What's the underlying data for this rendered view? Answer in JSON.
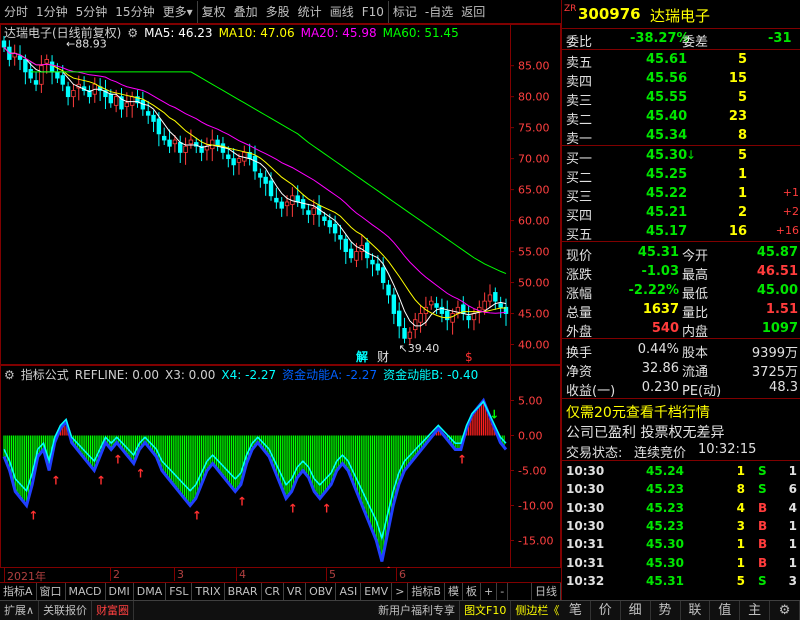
{
  "toolbar": {
    "items": [
      "分时",
      "1分钟",
      "5分钟",
      "15分钟",
      "更多",
      "复权",
      "叠加",
      "多股",
      "统计",
      "画线",
      "F10",
      "标记",
      "-自选",
      "返回"
    ],
    "more_chevron": "▾"
  },
  "main_header": {
    "title": "达瑞电子(日线前复权)",
    "ma5": "MA5: 46.23",
    "ma10": "MA10: 47.06",
    "ma20": "MA20: 45.98",
    "ma60": "MA60: 51.45"
  },
  "colors": {
    "up": "#ff3c3c",
    "down": "#00ffff",
    "ma5": "#ffffff",
    "ma10": "#ffff00",
    "ma20": "#ff00ff",
    "ma60": "#00ff00",
    "panel_border": "#800000"
  },
  "chart_data": [
    {
      "type": "candlestick",
      "title": "达瑞电子(日线前复权)",
      "y_ticks": [
        85.0,
        80.0,
        75.0,
        70.0,
        65.0,
        60.0,
        55.0,
        50.0,
        45.0,
        40.0
      ],
      "ylim": [
        37.5,
        88.5
      ],
      "x_ticks": [
        "2021年",
        "2",
        "3",
        "4",
        "5",
        "6"
      ],
      "annotations": {
        "high": "88.93",
        "low": "39.40",
        "mark1": "解",
        "mark2": "财",
        "mark3": "$"
      },
      "close": [
        88,
        86,
        87,
        86,
        84,
        83,
        82,
        85,
        86,
        84,
        83,
        82,
        80,
        81,
        82,
        81,
        80,
        82,
        81,
        80,
        79,
        80,
        78,
        79,
        80,
        79,
        78,
        77,
        76,
        74,
        73,
        72,
        73,
        71,
        72,
        73,
        72,
        71,
        72,
        73,
        72,
        71,
        70,
        69,
        70,
        71,
        70,
        68,
        67,
        66,
        64,
        63,
        62,
        63,
        64,
        63,
        62,
        61,
        62,
        61,
        60,
        59,
        58,
        57,
        55,
        54,
        55,
        56,
        54,
        53,
        52,
        50,
        48,
        45,
        43,
        41,
        42,
        44,
        45,
        46,
        47,
        46,
        45,
        44,
        45,
        46,
        45,
        44,
        45,
        46,
        47,
        48,
        47,
        46,
        45
      ],
      "ma60": [
        84,
        84,
        84,
        84,
        84,
        84,
        84,
        84,
        84,
        84,
        84,
        84,
        84,
        84,
        84,
        84,
        84,
        84,
        84,
        84,
        84,
        84,
        84,
        84,
        84,
        84,
        84,
        84,
        84,
        84,
        84,
        83.5,
        83,
        82.5,
        82,
        81.5,
        81,
        80.5,
        80,
        79.5,
        79,
        78.5,
        78,
        77.5,
        77,
        76.5,
        76,
        75.5,
        75,
        74.5,
        74,
        73.3,
        72.6,
        72,
        71.4,
        70.8,
        70.2,
        69.6,
        69,
        68.4,
        67.8,
        67.2,
        66.6,
        66,
        65.4,
        64.8,
        64.2,
        63.6,
        63,
        62.4,
        61.8,
        61.2,
        60.6,
        60,
        59.4,
        58.8,
        58.2,
        57.6,
        57,
        56.4,
        55.8,
        55.2,
        54.6,
        54,
        53.5,
        53,
        52.6,
        52.2,
        51.8,
        51.45
      ]
    },
    {
      "type": "area",
      "title": "指标公式",
      "labels": {
        "refline": "REFLINE: 0.00",
        "x3": "X3: 0.00",
        "x4": "X4: -2.27",
        "a": "资金动能A: -2.27",
        "b": "资金动能B: -0.40"
      },
      "y_ticks": [
        5.0,
        0.0,
        -5.0,
        -10.0,
        -15.0
      ],
      "ylim": [
        -18.5,
        7.5
      ],
      "values": [
        -3,
        -5,
        -8,
        -9,
        -10,
        -7,
        -3,
        -2,
        -5,
        -1,
        1,
        2,
        -1,
        -2,
        -3,
        -4,
        -5,
        -3,
        -1,
        -2,
        -1,
        -2,
        -3,
        -4,
        -2,
        -1,
        -2,
        -3,
        -5,
        -6,
        -7,
        -8,
        -9,
        -10,
        -9,
        -7,
        -5,
        -4,
        -5,
        -6,
        -7,
        -8,
        -7,
        -4,
        -2,
        -1,
        -2,
        -3,
        -5,
        -7,
        -9,
        -8,
        -6,
        -5,
        -6,
        -8,
        -9,
        -8,
        -7,
        -5,
        -4,
        -5,
        -7,
        -9,
        -11,
        -13,
        -15,
        -18,
        -14,
        -10,
        -7,
        -5,
        -4,
        -3,
        -2,
        -1,
        0,
        1,
        0,
        -1,
        -2,
        -2,
        1,
        3,
        4,
        5,
        3,
        1,
        -1,
        -2
      ]
    }
  ],
  "bottom_tabs": [
    "指标A",
    "窗口",
    "MACD",
    "DMI",
    "DMA",
    "FSL",
    "TRIX",
    "BRAR",
    "CR",
    "VR",
    "OBV",
    "ASI",
    "EMV",
    ">",
    "指标B",
    "模",
    "板",
    "+",
    "-",
    "日线"
  ],
  "status_bar": [
    "扩展∧",
    "关联报价",
    "财富圈",
    "新用户福利专享",
    "图文F10",
    "侧边栏《"
  ],
  "quote": {
    "code": "300976",
    "name": "达瑞电子",
    "zr": "ZR",
    "wei_bi_label": "委比",
    "wei_bi": "-38.27%",
    "wei_cha_label": "委差",
    "wei_cha": "-31",
    "asks": [
      {
        "label": "卖五",
        "price": "45.61",
        "vol": "5"
      },
      {
        "label": "卖四",
        "price": "45.56",
        "vol": "15"
      },
      {
        "label": "卖三",
        "price": "45.55",
        "vol": "5"
      },
      {
        "label": "卖二",
        "price": "45.40",
        "vol": "23"
      },
      {
        "label": "卖一",
        "price": "45.34",
        "vol": "8"
      }
    ],
    "bids": [
      {
        "label": "买一",
        "price": "45.30",
        "vol": "5",
        "chg": "",
        "arrow": "↓"
      },
      {
        "label": "买二",
        "price": "45.25",
        "vol": "1",
        "chg": "",
        "arrow": ""
      },
      {
        "label": "买三",
        "price": "45.22",
        "vol": "1",
        "chg": "+1",
        "arrow": ""
      },
      {
        "label": "买四",
        "price": "45.21",
        "vol": "2",
        "chg": "+2",
        "arrow": ""
      },
      {
        "label": "买五",
        "price": "45.17",
        "vol": "16",
        "chg": "+16",
        "arrow": ""
      }
    ],
    "stats": [
      {
        "l1": "现价",
        "v1": "45.31",
        "c1": "grn",
        "l2": "今开",
        "v2": "45.87",
        "c2": "grn"
      },
      {
        "l1": "涨跌",
        "v1": "-1.03",
        "c1": "grn",
        "l2": "最高",
        "v2": "46.51",
        "c2": "red"
      },
      {
        "l1": "涨幅",
        "v1": "-2.22%",
        "c1": "grn",
        "l2": "最低",
        "v2": "45.00",
        "c2": "grn"
      },
      {
        "l1": "总量",
        "v1": "1637",
        "c1": "yel",
        "l2": "量比",
        "v2": "1.51",
        "c2": "red"
      },
      {
        "l1": "外盘",
        "v1": "540",
        "c1": "red",
        "l2": "内盘",
        "v2": "1097",
        "c2": "grn"
      }
    ],
    "fin": [
      {
        "l1": "换手",
        "v1": "0.44%",
        "l2": "股本",
        "v2": "9399万"
      },
      {
        "l1": "净资",
        "v1": "32.86",
        "l2": "流通",
        "v2": "3725万"
      },
      {
        "l1": "收益(一)",
        "v1": "0.230",
        "l2": "PE(动)",
        "v2": "48.3"
      }
    ],
    "promo": "仅需20元查看千档行情",
    "note": "公司已盈利 投票权无差异",
    "trade_state_label": "交易状态:",
    "trade_state": "连续竞价",
    "trade_time": "10:32:15",
    "ticks": [
      {
        "t": "10:30",
        "p": "45.24",
        "v": "1",
        "s": "S",
        "n": "1"
      },
      {
        "t": "10:30",
        "p": "45.23",
        "v": "8",
        "s": "S",
        "n": "6"
      },
      {
        "t": "10:30",
        "p": "45.23",
        "v": "4",
        "s": "B",
        "n": "4"
      },
      {
        "t": "10:30",
        "p": "45.23",
        "v": "3",
        "s": "B",
        "n": "1"
      },
      {
        "t": "10:31",
        "p": "45.30",
        "v": "1",
        "s": "B",
        "n": "1"
      },
      {
        "t": "10:31",
        "p": "45.30",
        "v": "1",
        "s": "B",
        "n": "1"
      },
      {
        "t": "10:32",
        "p": "45.31",
        "v": "5",
        "s": "S",
        "n": "3"
      }
    ]
  },
  "rp_tabs": [
    "笔",
    "价",
    "细",
    "势",
    "联",
    "值",
    "主",
    "⚙"
  ]
}
